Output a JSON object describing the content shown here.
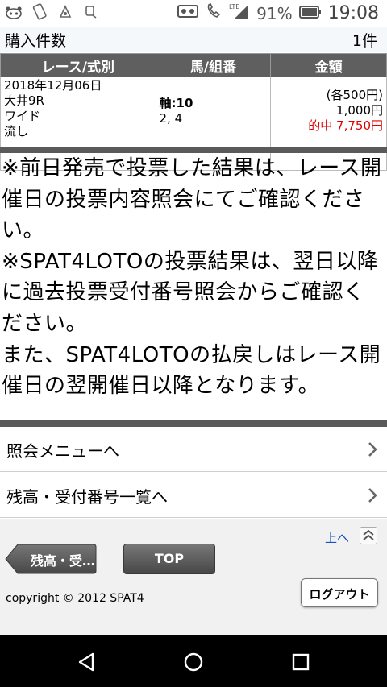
{
  "status_bar": {
    "battery_percent": "91%",
    "time": "19:08",
    "network": "LTE",
    "icons": [
      "panda-icon",
      "phone-rotate-icon",
      "app-icon",
      "signal-app-icon",
      "voicemail-icon",
      "call-icon",
      "lte-signal-icon",
      "battery-icon"
    ]
  },
  "summary": {
    "label": "購入件数",
    "value": "1件"
  },
  "table": {
    "headers": [
      "レース/式別",
      "馬/組番",
      "金額"
    ],
    "row": {
      "date": "2018年12月06日",
      "race": "大井9R",
      "bet_type": "ワイド",
      "method": "流し",
      "axis": "軸:10",
      "partners": "2, 4",
      "unit_amount": "(各500円)",
      "total_amount": "1,000円",
      "payout": "的中 7,750円"
    }
  },
  "notes": [
    "※前日発売で投票した結果は、レース開催日の投票内容照会にてご確認ください。",
    "※SPAT4LOTOの投票結果は、翌日以降に過去投票受付番号照会からご確認ください。",
    "また、SPAT4LOTOの払戻しはレース開催日の翌開催日以降となります。"
  ],
  "menu": [
    {
      "label": "照会メニューへ"
    },
    {
      "label": "残高・受付番号一覧へ"
    }
  ],
  "footer": {
    "to_top_link": "上へ",
    "back_button": "残高・受…",
    "top_button": "TOP",
    "logout_button": "ログアウト",
    "copyright": "copyright © 2012 SPAT4"
  },
  "colors": {
    "header_bg": "#5f5f5f",
    "hit_red": "#e00000",
    "link_blue": "#1a4fc4"
  }
}
